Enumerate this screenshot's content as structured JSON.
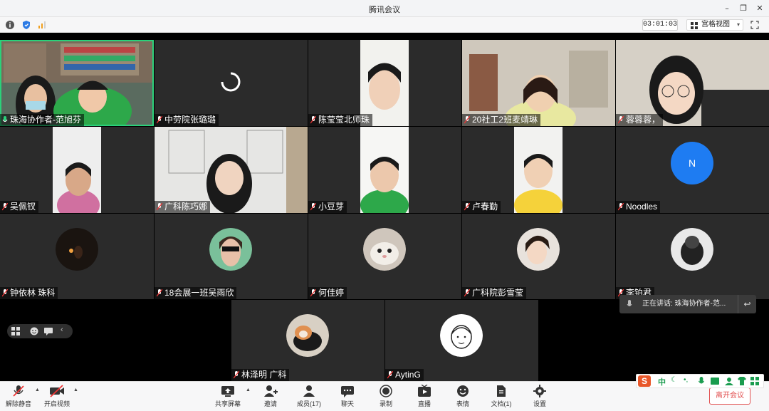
{
  "window": {
    "title": "腾讯会议"
  },
  "toolbar": {
    "timer": "03:01:03",
    "layout_label": "宫格视图"
  },
  "participants": [
    {
      "name": "珠海协作者-范旭芬"
    },
    {
      "name": "中劳院张璐璐"
    },
    {
      "name": "陈莹莹北师珠"
    },
    {
      "name": "20社工2班麦靖琳"
    },
    {
      "name": "蓉蓉蓉，"
    },
    {
      "name": "吴佩钗"
    },
    {
      "name": "广科陈巧娜"
    },
    {
      "name": "小豆芽"
    },
    {
      "name": "卢春勤"
    },
    {
      "name": "Noodles"
    },
    {
      "name": "钟依林 珠科"
    },
    {
      "name": "18会展一班吴雨欣"
    },
    {
      "name": "何佳婷"
    },
    {
      "name": "广科院彭雪莹"
    },
    {
      "name": "李铂君"
    },
    {
      "name": "林泽明 广科"
    },
    {
      "name": "AytinG"
    }
  ],
  "n_avatar_letter": "N",
  "speaking": {
    "text": "正在讲话: 珠海协作者-范..."
  },
  "bottom": {
    "unmute": "解除静音",
    "start_video": "开启视频",
    "share": "共享屏幕",
    "invite": "邀请",
    "members": "成员(17)",
    "chat": "聊天",
    "record": "录制",
    "live": "直播",
    "emoji": "表情",
    "docs": "文档(1)",
    "settings": "设置",
    "leave": "离开会议"
  },
  "ime": {
    "logo": "S",
    "lang": "中"
  }
}
